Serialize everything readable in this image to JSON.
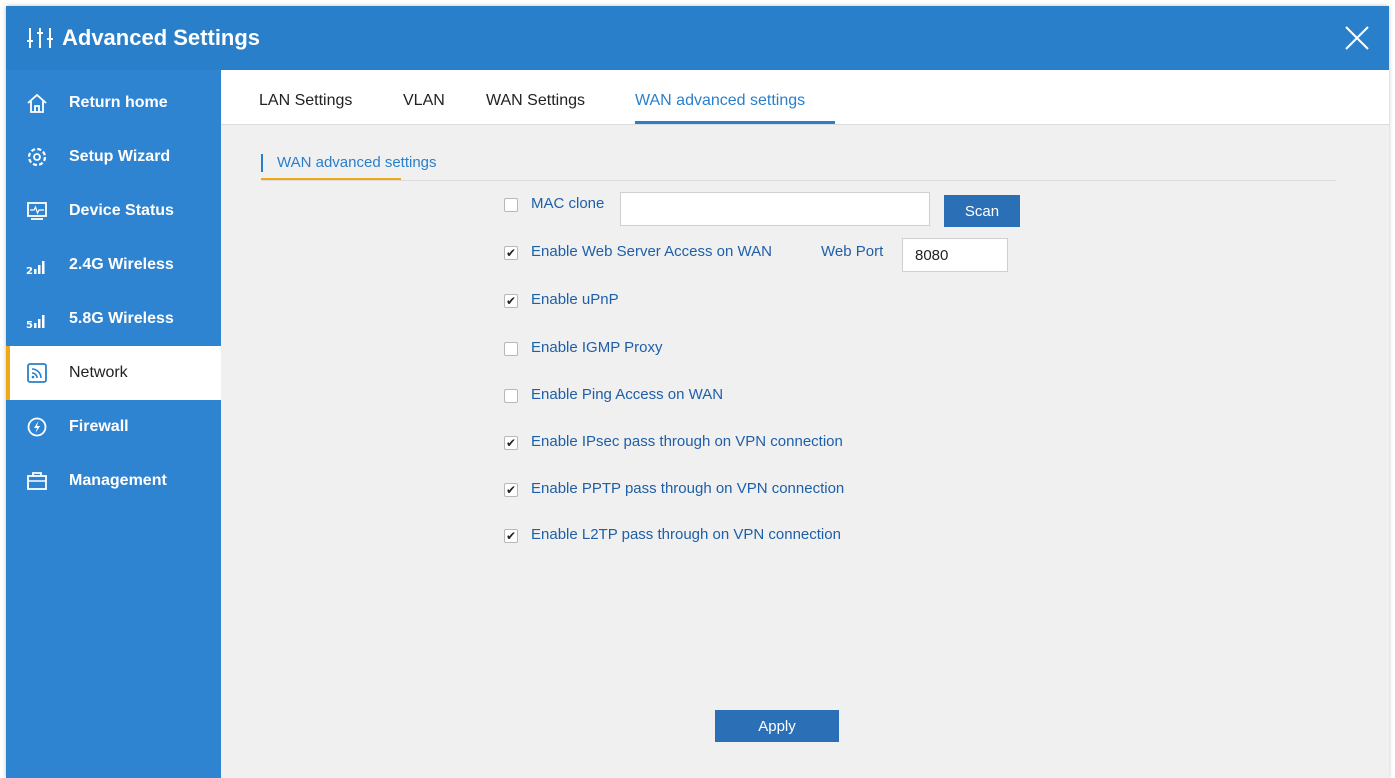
{
  "window": {
    "title": "Advanced Settings",
    "title_icon": "sliders-icon",
    "close_icon": "close-icon",
    "accent_color": "#2a7fcb",
    "sidebar_color": "#2f84d2",
    "highlight_color": "#f0a818"
  },
  "sidebar": {
    "items": [
      {
        "label": "Return home",
        "icon": "home-icon",
        "active": false
      },
      {
        "label": "Setup Wizard",
        "icon": "gear-icon",
        "active": false
      },
      {
        "label": "Device Status",
        "icon": "monitor-icon",
        "active": false
      },
      {
        "label": "2.4G Wireless",
        "icon": "signal-2g-icon",
        "active": false
      },
      {
        "label": "5.8G Wireless",
        "icon": "signal-5g-icon",
        "active": false
      },
      {
        "label": "Network",
        "icon": "network-icon",
        "active": true
      },
      {
        "label": "Firewall",
        "icon": "shield-icon",
        "active": false
      },
      {
        "label": "Management",
        "icon": "toolbox-icon",
        "active": false
      }
    ]
  },
  "tabs": [
    {
      "label": "LAN Settings",
      "active": false
    },
    {
      "label": "VLAN",
      "active": false
    },
    {
      "label": "WAN Settings",
      "active": false
    },
    {
      "label": "WAN advanced settings",
      "active": true
    }
  ],
  "section": {
    "title": "WAN advanced settings"
  },
  "form": {
    "mac_clone": {
      "label": "MAC clone",
      "checked": false,
      "value": "",
      "scan_label": "Scan"
    },
    "web_access": {
      "label": "Enable Web Server Access on WAN",
      "checked": true,
      "port_label": "Web Port",
      "port_value": "8080"
    },
    "options": [
      {
        "label": "Enable uPnP",
        "checked": true
      },
      {
        "label": "Enable IGMP Proxy",
        "checked": false
      },
      {
        "label": "Enable Ping Access on WAN",
        "checked": false
      },
      {
        "label": "Enable IPsec pass through on VPN connection",
        "checked": true
      },
      {
        "label": "Enable PPTP pass through on VPN connection",
        "checked": true
      },
      {
        "label": "Enable L2TP pass through on VPN connection",
        "checked": true
      }
    ],
    "apply_label": "Apply"
  }
}
